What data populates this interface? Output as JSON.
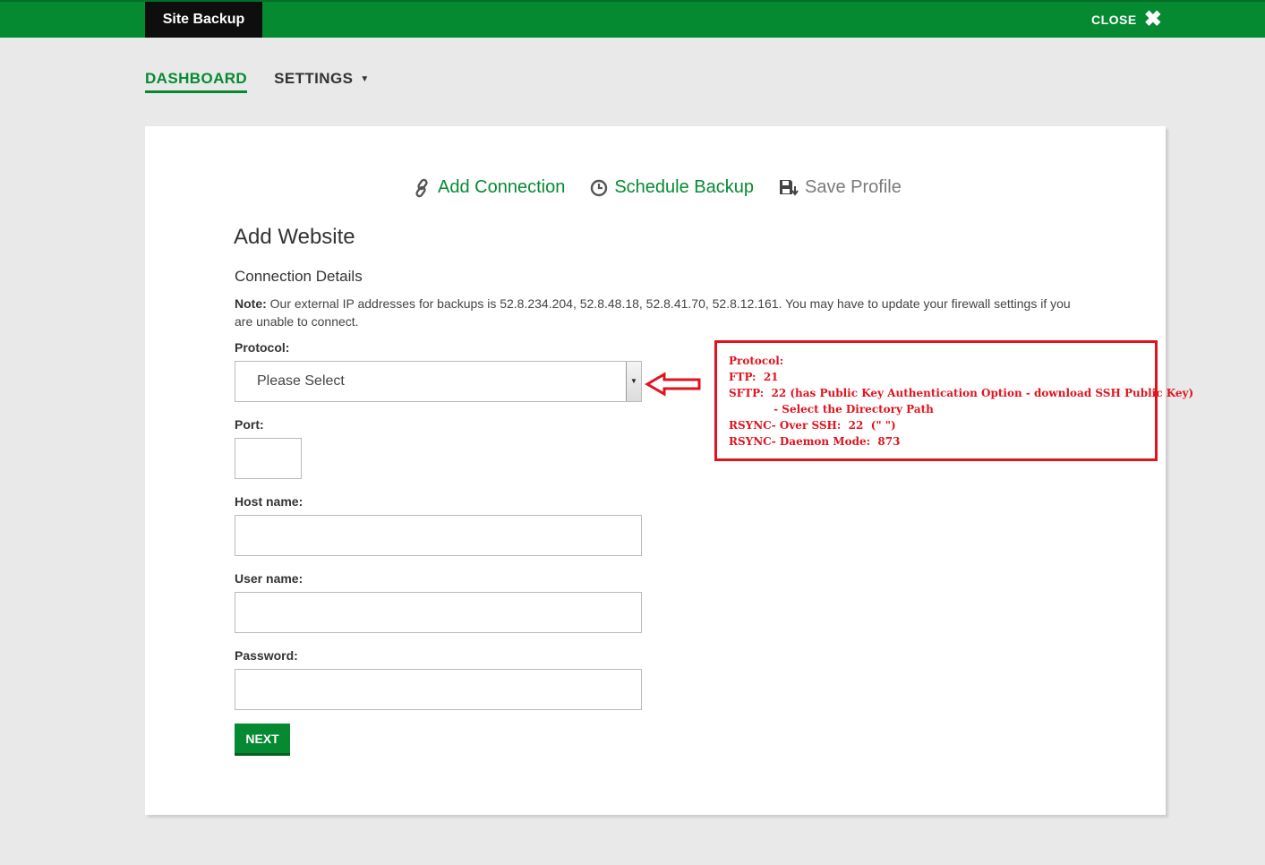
{
  "header": {
    "app_title": "Site Backup",
    "close_label": "CLOSE",
    "brand_color": "#058a32"
  },
  "nav": {
    "dashboard": "DASHBOARD",
    "settings": "SETTINGS"
  },
  "actions": {
    "add_connection": "Add Connection",
    "schedule_backup": "Schedule Backup",
    "save_profile": "Save Profile"
  },
  "form": {
    "title": "Add Website",
    "section_title": "Connection Details",
    "note_label": "Note:",
    "note_text": "Our external IP addresses for backups is 52.8.234.204, 52.8.48.18, 52.8.41.70, 52.8.12.161. You may have to update your firewall settings if you are unable to connect.",
    "protocol_label": "Protocol:",
    "protocol_value": "Please Select",
    "port_label": "Port:",
    "host_label": "Host name:",
    "user_label": "User name:",
    "password_label": "Password:",
    "next_label": "NEXT"
  },
  "annotation": {
    "color": "#e0141e",
    "lines": [
      "Protocol:",
      "FTP:  21",
      "SFTP:  22 (has Public Key Authentication Option - download SSH Public Key)",
      "            - Select the Directory Path",
      "RSYNC- Over SSH:  22  (\" \")",
      "RSYNC- Daemon Mode:  873"
    ]
  }
}
